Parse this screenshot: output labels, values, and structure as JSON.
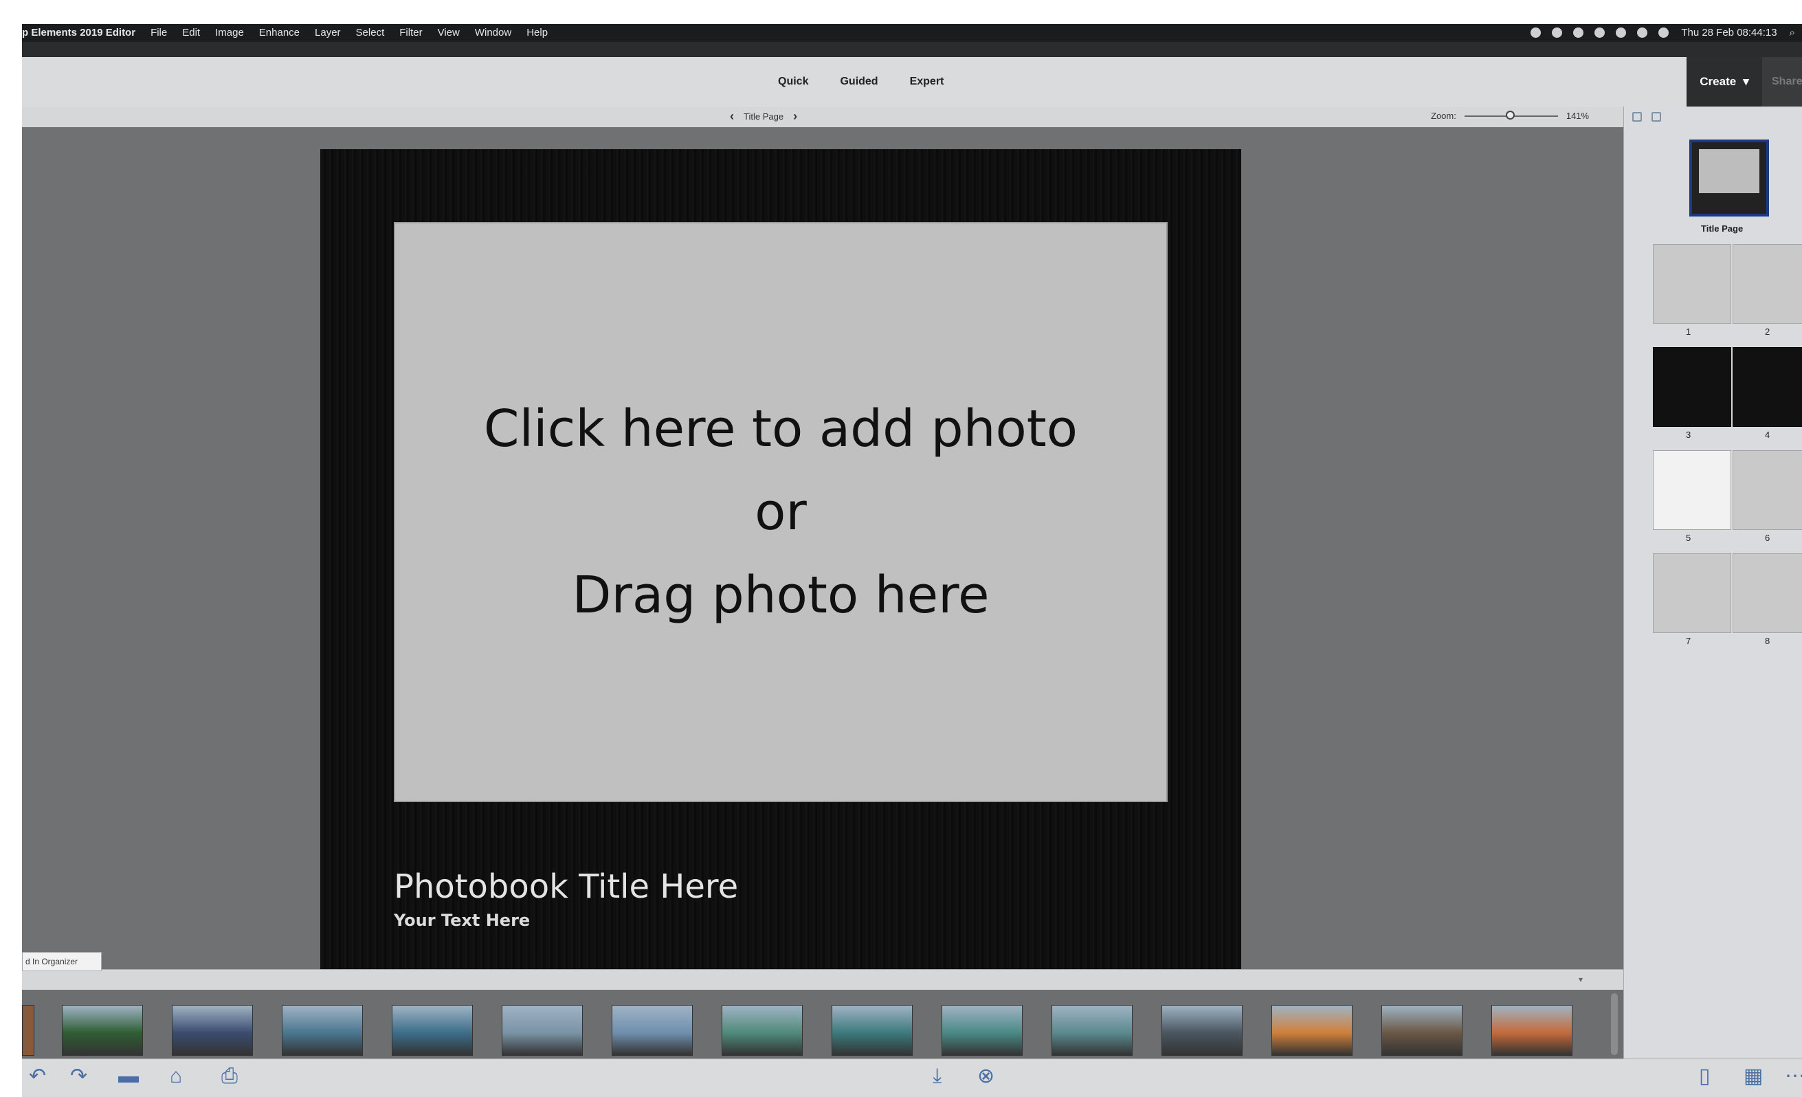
{
  "menubar": {
    "app_name": "p Elements 2019 Editor",
    "menus": [
      "File",
      "Edit",
      "Image",
      "Enhance",
      "Layer",
      "Select",
      "Filter",
      "View",
      "Window",
      "Help"
    ],
    "clock": "Thu 28 Feb 08:44:13"
  },
  "modes": {
    "quick": "Quick",
    "guided": "Guided",
    "expert": "Expert"
  },
  "create_label": "Create",
  "share_label": "Share",
  "page_nav": {
    "current": "Title Page"
  },
  "zoom": {
    "label": "Zoom:",
    "value": "141%"
  },
  "canvas": {
    "drop_line1": "Click here to add photo",
    "drop_line2": "or",
    "drop_line3": "Drag photo here",
    "title": "Photobook Title Here",
    "subtitle": "Your Text Here"
  },
  "pages_panel": {
    "title_label": "Title Page",
    "page_numbers": [
      "1",
      "2",
      "3",
      "4",
      "5",
      "6",
      "7",
      "8"
    ]
  },
  "photo_bin": {
    "tab_label": "d In Organizer",
    "thumb_colors": [
      "#2f5e33",
      "#3b4c70",
      "#4a7790",
      "#3c6e8a",
      "#7a93a6",
      "#6f8fae",
      "#4f8a7a",
      "#3c7a7d",
      "#4a8a86",
      "#5a8a8e",
      "#4a5660",
      "#d0803a",
      "#6a5844",
      "#c46a3a"
    ]
  },
  "colors": {
    "accent": "#1c3a82",
    "app_bg": "#6f7173",
    "panel_bg": "#d9dbdf"
  }
}
